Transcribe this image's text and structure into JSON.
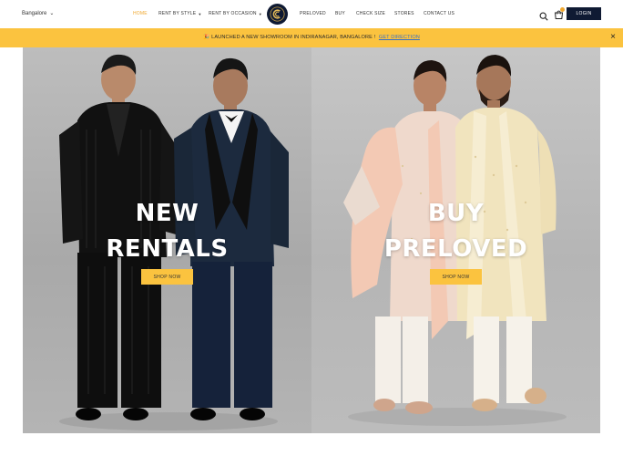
{
  "header": {
    "location": "Bangalore",
    "nav": [
      {
        "label": "HOME",
        "active": true,
        "dropdown": false
      },
      {
        "label": "RENT BY STYLE",
        "active": false,
        "dropdown": true
      },
      {
        "label": "RENT BY OCCASION",
        "active": false,
        "dropdown": true
      },
      {
        "label": "PRELOVED",
        "active": false,
        "dropdown": false
      },
      {
        "label": "BUY",
        "active": false,
        "dropdown": false
      },
      {
        "label": "CHECK SIZE",
        "active": false,
        "dropdown": false
      },
      {
        "label": "STORES",
        "active": false,
        "dropdown": false
      },
      {
        "label": "CONTACT US",
        "active": false,
        "dropdown": false
      }
    ],
    "login_label": "LOGIN",
    "cart_count": "",
    "icons": {
      "search": "search-icon",
      "cart": "cart-icon",
      "logo": "logo-icon",
      "location_caret": "chevron-down-icon"
    }
  },
  "announcement": {
    "emoji": "🎉",
    "text": "LAUNCHED A NEW SHOWROOM IN INDIRANAGAR, BANGALORE !",
    "link": "GET DIRECTION",
    "close": "×"
  },
  "hero": {
    "left": {
      "line1": "NEW",
      "line2": "RENTALS",
      "button": "SHOP NOW"
    },
    "right": {
      "line1": "BUY",
      "line2": "PRELOVED",
      "button": "SHOP NOW"
    }
  },
  "colors": {
    "accent": "#fbc33f",
    "active_nav": "#f0a830",
    "navy": "#0f1a33",
    "link": "#3a6fc4"
  }
}
